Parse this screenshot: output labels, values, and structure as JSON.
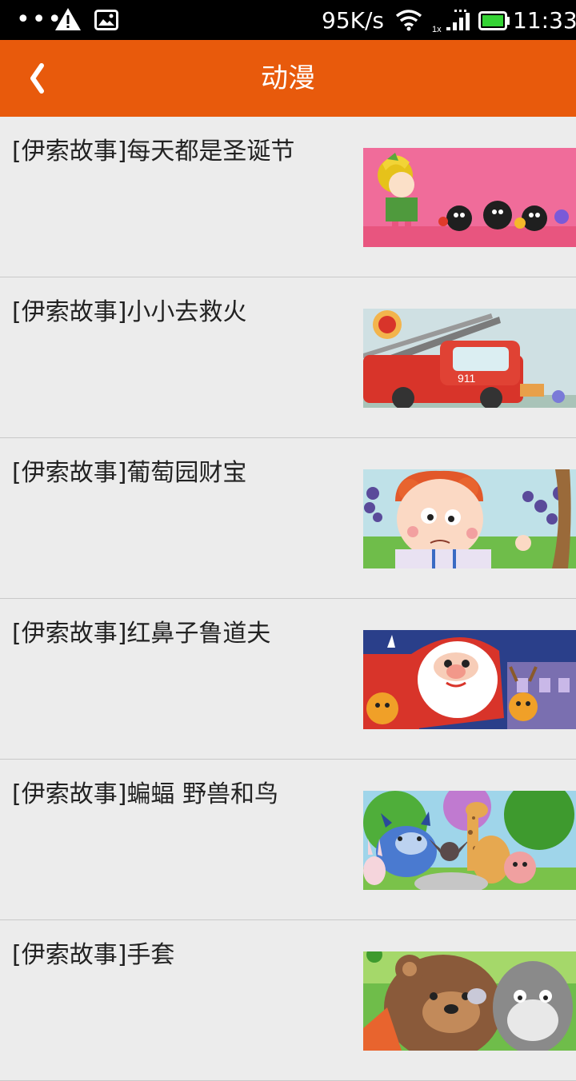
{
  "status_bar": {
    "dots": "•••",
    "net_speed": "95K/s",
    "time": "11:33",
    "icons": [
      "warning-icon",
      "image-icon",
      "wifi-icon",
      "signal-icon",
      "battery-icon"
    ]
  },
  "header": {
    "back_icon": "chevron-left-icon",
    "title": "动漫"
  },
  "items": [
    {
      "label": "[伊索故事]每天都是圣诞节"
    },
    {
      "label": "[伊索故事]小小去救火"
    },
    {
      "label": "[伊索故事]葡萄园财宝"
    },
    {
      "label": "[伊索故事]红鼻子鲁道夫"
    },
    {
      "label": "[伊索故事]蝙蝠 野兽和鸟"
    },
    {
      "label": "[伊索故事]手套"
    }
  ],
  "colors": {
    "app_bar": "#e85a0c",
    "background": "#ececec",
    "divider": "#c9c9c9"
  }
}
